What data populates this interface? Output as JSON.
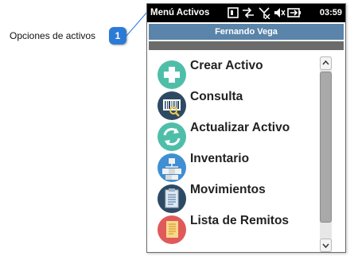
{
  "callout": {
    "badge_number": "1",
    "label": "Opciones de activos"
  },
  "window": {
    "title": "Menú Activos",
    "clock": "03:59"
  },
  "status_icons": [
    "window-icon",
    "connectivity-icon",
    "no-signal-icon",
    "speaker-muted-icon",
    "battery-icon"
  ],
  "user_bar": {
    "name": "Fernando Vega"
  },
  "menu": {
    "items": [
      {
        "label": "Crear Activo",
        "icon": "add-plus-icon",
        "color": "#4fbea9"
      },
      {
        "label": "Consulta",
        "icon": "barcode-search-icon",
        "color": "#2e4a63"
      },
      {
        "label": "Actualizar Activo",
        "icon": "refresh-arrows-icon",
        "color": "#4fbea9"
      },
      {
        "label": "Inventario",
        "icon": "boxes-hierarchy-icon",
        "color": "#3f8fd2"
      },
      {
        "label": "Movimientos",
        "icon": "clipboard-icon",
        "color": "#2e4a63"
      },
      {
        "label": "Lista de Remitos",
        "icon": "document-list-icon",
        "color": "#e05a5a"
      }
    ]
  },
  "colors": {
    "title_bar": "#000000",
    "user_bar": "#5a84a9",
    "callout_badge": "#2b7bd6"
  }
}
